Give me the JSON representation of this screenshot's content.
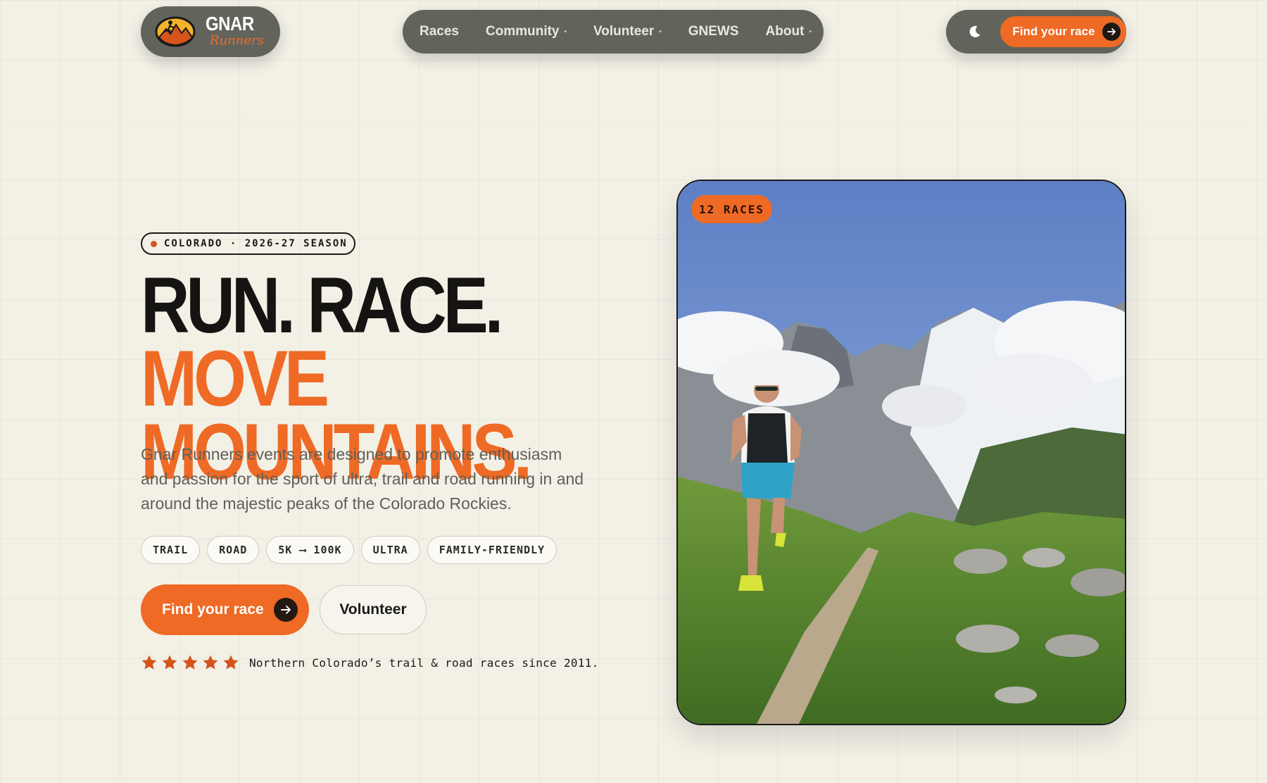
{
  "brand": {
    "name_line1": "GNAR",
    "name_line2": "Runners"
  },
  "nav": {
    "items": [
      {
        "label": "Races",
        "has_dropdown": false
      },
      {
        "label": "Community",
        "has_dropdown": true
      },
      {
        "label": "Volunteer",
        "has_dropdown": true
      },
      {
        "label": "GNEWS",
        "has_dropdown": false
      },
      {
        "label": "About",
        "has_dropdown": true
      }
    ]
  },
  "header_cta": {
    "theme_toggle_icon": "moon-icon",
    "find_race_label": "Find your race"
  },
  "hero": {
    "season_badge": "COLORADO · 2026-27 SEASON",
    "headline_dark": "RUN. RACE.",
    "headline_orange_1": "MOVE",
    "headline_orange_2": "MOUNTAINS.",
    "lede": "Gnar Runners events are designed to promote enthusiasm and passion for the sport of ultra, trail and road running in and around the majestic peaks of the Colorado Rockies.",
    "tags": [
      "TRAIL",
      "ROAD",
      "5K ⟶ 100K",
      "ULTRA",
      "FAMILY-FRIENDLY"
    ],
    "primary_button": "Find your race",
    "secondary_button": "Volunteer",
    "rating_stars": 5,
    "rating_text": "Northern Colorado’s trail & road races since 2011.",
    "image_badge": "12 RACES"
  },
  "colors": {
    "accent": "#ee6a25",
    "header_pill": "#62645c",
    "background": "#f3f0e6",
    "star": "#d4541c"
  }
}
